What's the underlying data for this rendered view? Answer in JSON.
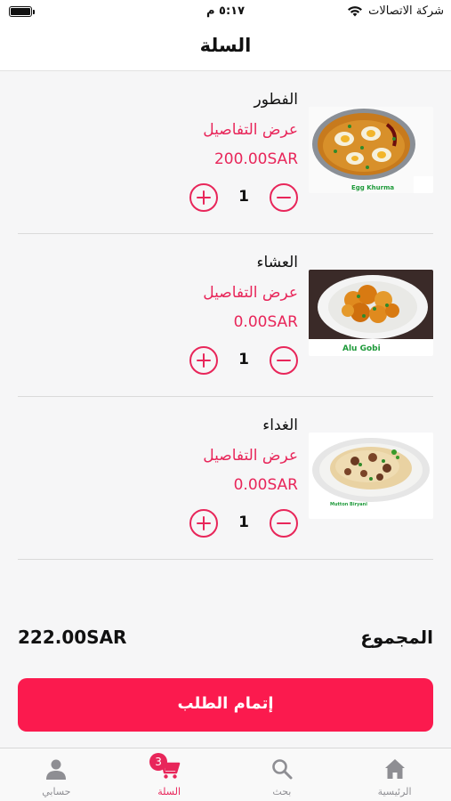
{
  "status_bar": {
    "carrier": "شركة الاتصالات",
    "time": "٥:١٧ م"
  },
  "header": {
    "title": "السلة"
  },
  "items": [
    {
      "name": "الفطور",
      "details_label": "عرض التفاصيل",
      "price": "200.00SAR",
      "quantity": "1",
      "image_caption": "Egg Khurma"
    },
    {
      "name": "العشاء",
      "details_label": "عرض التفاصيل",
      "price": "0.00SAR",
      "quantity": "1",
      "image_caption": "Alu Gobi"
    },
    {
      "name": "الغداء",
      "details_label": "عرض التفاصيل",
      "price": "0.00SAR",
      "quantity": "1",
      "image_caption": "Mutton Biryani"
    }
  ],
  "summary": {
    "total_label": "المجموع",
    "total_value": "222.00SAR"
  },
  "checkout": {
    "label": "إتمام الطلب"
  },
  "tab_bar": {
    "tabs": [
      {
        "label": "الرئيسية",
        "icon": "home-icon"
      },
      {
        "label": "بحث",
        "icon": "search-icon"
      },
      {
        "label": "السلة",
        "icon": "cart-icon",
        "badge": "3"
      },
      {
        "label": "حسابي",
        "icon": "user-icon"
      }
    ]
  },
  "colors": {
    "accent": "#e8265a",
    "button": "#fb1a4e",
    "tab_inactive": "#8e8e93"
  }
}
